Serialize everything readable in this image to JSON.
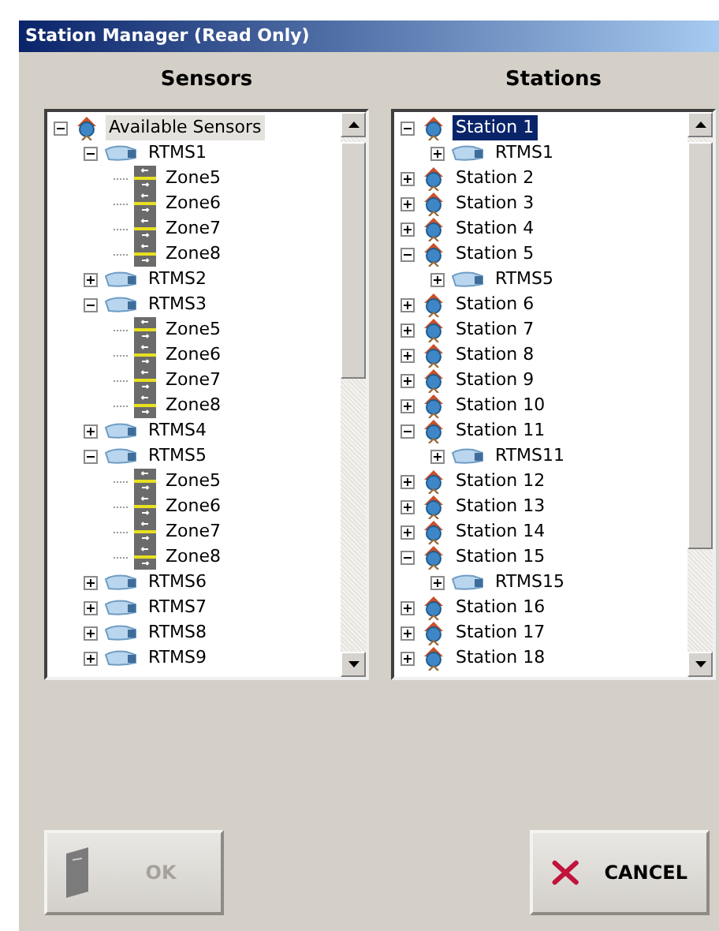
{
  "window": {
    "title": "Station Manager (Read Only)"
  },
  "panels": [
    {
      "heading": "Sensors",
      "tree": [
        {
          "kind": "root",
          "label": "Available Sensors",
          "selected": false,
          "expanded": true,
          "children": [
            {
              "kind": "sensor",
              "label": "RTMS1",
              "selected": false,
              "expanded": true,
              "children": [
                {
                  "kind": "zone",
                  "label": "Zone5",
                  "selected": false
                },
                {
                  "kind": "zone",
                  "label": "Zone6",
                  "selected": false
                },
                {
                  "kind": "zone",
                  "label": "Zone7",
                  "selected": false
                },
                {
                  "kind": "zone",
                  "label": "Zone8",
                  "selected": false
                }
              ]
            },
            {
              "kind": "sensor",
              "label": "RTMS2",
              "selected": false,
              "expanded": false
            },
            {
              "kind": "sensor",
              "label": "RTMS3",
              "selected": false,
              "expanded": true,
              "children": [
                {
                  "kind": "zone",
                  "label": "Zone5",
                  "selected": false
                },
                {
                  "kind": "zone",
                  "label": "Zone6",
                  "selected": false
                },
                {
                  "kind": "zone",
                  "label": "Zone7",
                  "selected": false
                },
                {
                  "kind": "zone",
                  "label": "Zone8",
                  "selected": false
                }
              ]
            },
            {
              "kind": "sensor",
              "label": "RTMS4",
              "selected": false,
              "expanded": false
            },
            {
              "kind": "sensor",
              "label": "RTMS5",
              "selected": false,
              "expanded": true,
              "children": [
                {
                  "kind": "zone",
                  "label": "Zone5",
                  "selected": false
                },
                {
                  "kind": "zone",
                  "label": "Zone6",
                  "selected": false
                },
                {
                  "kind": "zone",
                  "label": "Zone7",
                  "selected": false
                },
                {
                  "kind": "zone",
                  "label": "Zone8",
                  "selected": false
                }
              ]
            },
            {
              "kind": "sensor",
              "label": "RTMS6",
              "selected": false,
              "expanded": false
            },
            {
              "kind": "sensor",
              "label": "RTMS7",
              "selected": false,
              "expanded": false
            },
            {
              "kind": "sensor",
              "label": "RTMS8",
              "selected": false,
              "expanded": false
            },
            {
              "kind": "sensor",
              "label": "RTMS9",
              "selected": false,
              "expanded": false
            }
          ]
        }
      ]
    },
    {
      "heading": "Stations",
      "tree": [
        {
          "kind": "station",
          "label": "Station 1",
          "selected": true,
          "expanded": true,
          "children": [
            {
              "kind": "sensor",
              "label": "RTMS1",
              "selected": false,
              "expanded": false
            }
          ]
        },
        {
          "kind": "station",
          "label": "Station 2",
          "selected": false,
          "expanded": false
        },
        {
          "kind": "station",
          "label": "Station 3",
          "selected": false,
          "expanded": false
        },
        {
          "kind": "station",
          "label": "Station 4",
          "selected": false,
          "expanded": false
        },
        {
          "kind": "station",
          "label": "Station 5",
          "selected": false,
          "expanded": true,
          "children": [
            {
              "kind": "sensor",
              "label": "RTMS5",
              "selected": false,
              "expanded": false
            }
          ]
        },
        {
          "kind": "station",
          "label": "Station 6",
          "selected": false,
          "expanded": false
        },
        {
          "kind": "station",
          "label": "Station 7",
          "selected": false,
          "expanded": false
        },
        {
          "kind": "station",
          "label": "Station 8",
          "selected": false,
          "expanded": false
        },
        {
          "kind": "station",
          "label": "Station 9",
          "selected": false,
          "expanded": false
        },
        {
          "kind": "station",
          "label": "Station 10",
          "selected": false,
          "expanded": false
        },
        {
          "kind": "station",
          "label": "Station 11",
          "selected": false,
          "expanded": true,
          "children": [
            {
              "kind": "sensor",
              "label": "RTMS11",
              "selected": false,
              "expanded": false
            }
          ]
        },
        {
          "kind": "station",
          "label": "Station 12",
          "selected": false,
          "expanded": false
        },
        {
          "kind": "station",
          "label": "Station 13",
          "selected": false,
          "expanded": false
        },
        {
          "kind": "station",
          "label": "Station 14",
          "selected": false,
          "expanded": false
        },
        {
          "kind": "station",
          "label": "Station 15",
          "selected": false,
          "expanded": true,
          "children": [
            {
              "kind": "sensor",
              "label": "RTMS15",
              "selected": false,
              "expanded": false
            }
          ]
        },
        {
          "kind": "station",
          "label": "Station 16",
          "selected": false,
          "expanded": false
        },
        {
          "kind": "station",
          "label": "Station 17",
          "selected": false,
          "expanded": false
        },
        {
          "kind": "station",
          "label": "Station 18",
          "selected": false,
          "expanded": false
        }
      ]
    }
  ],
  "buttons": [
    {
      "kind": "ok",
      "label": "OK",
      "disabled": true
    },
    {
      "kind": "cancel",
      "label": "CANCEL",
      "disabled": false
    }
  ]
}
